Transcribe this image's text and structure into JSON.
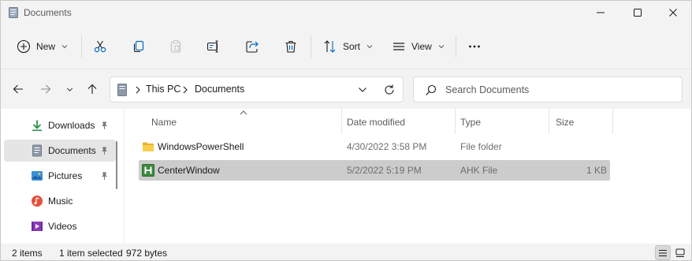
{
  "window": {
    "title": "Documents",
    "title_icon": "documents-folder-icon"
  },
  "command_bar": {
    "new_label": "New",
    "sort_label": "Sort",
    "view_label": "View",
    "icons": [
      "plus-circle-icon",
      "cut-icon",
      "copy-icon",
      "paste-icon",
      "rename-icon",
      "share-icon",
      "delete-icon",
      "sort-icon",
      "view-icon",
      "more-icon"
    ]
  },
  "address_bar": {
    "crumbs": [
      "This PC",
      "Documents"
    ]
  },
  "search": {
    "placeholder": "Search Documents"
  },
  "sidebar": {
    "items": [
      {
        "label": "Downloads",
        "icon": "download-icon",
        "pinned": true,
        "selected": false
      },
      {
        "label": "Documents",
        "icon": "documents-icon",
        "pinned": true,
        "selected": true
      },
      {
        "label": "Pictures",
        "icon": "pictures-icon",
        "pinned": true,
        "selected": false
      },
      {
        "label": "Music",
        "icon": "music-icon",
        "pinned": false,
        "selected": false
      },
      {
        "label": "Videos",
        "icon": "videos-icon",
        "pinned": false,
        "selected": false
      }
    ]
  },
  "file_list": {
    "columns": [
      "Name",
      "Date modified",
      "Type",
      "Size"
    ],
    "sorted_by": "Name",
    "rows": [
      {
        "name": "WindowsPowerShell",
        "date": "4/30/2022 3:58 PM",
        "type": "File folder",
        "size": "",
        "icon": "folder-icon",
        "selected": false
      },
      {
        "name": "CenterWindow",
        "date": "5/2/2022 5:19 PM",
        "type": "AHK File",
        "size": "1 KB",
        "icon": "ahk-file-icon",
        "selected": true
      }
    ]
  },
  "status_bar": {
    "item_count": "2 items",
    "selection": "1 item selected",
    "selection_size": "972 bytes"
  },
  "colors": {
    "selected_row": "#cccccc",
    "selected_nav": "#e5e5e5",
    "folder_yellow": "#f4c542",
    "ahk_green": "#3b8a3e",
    "accent_blue": "#0067c0"
  }
}
